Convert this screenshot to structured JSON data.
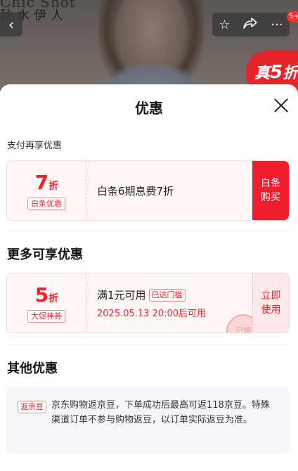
{
  "hero": {
    "brand_en": "Chic Shot",
    "brand_cn": "秋水伊人",
    "back_icon": "chevron-left-icon",
    "actions": [
      "star-icon",
      "share-icon",
      "more-icon"
    ],
    "notification_count": "5+",
    "promo_tag_prefix": "真",
    "promo_tag_num": "5",
    "promo_tag_suffix": "折"
  },
  "sheet": {
    "title": "优惠",
    "close_icon": "close-icon",
    "pay_section_label": "支付再享优惠",
    "pay_coupon": {
      "discount_num": "7",
      "discount_unit": "折",
      "tag": "白条优惠",
      "description": "白条6期息费7折",
      "action_line1": "白条",
      "action_line2": "购买"
    },
    "more_section_title": "更多可享优惠",
    "more_coupon": {
      "discount_num": "5",
      "discount_unit": "折",
      "tag": "大促神券",
      "description": "满1元可用",
      "threshold_tag": "已达门槛",
      "validity": "2025.05.13 20:00后可用",
      "action_line1": "立即",
      "action_line2": "使用",
      "stamp": "已领"
    },
    "other_section_title": "其他优惠",
    "other_item": {
      "tag": "返京豆",
      "text": "京东购物返京豆，下单成功后最高可返118京豆。特殊渠道订单不参与购物返豆，以订单实际返豆为准。"
    }
  },
  "colors": {
    "accent": "#e8242a",
    "accent_button": "#f01d2e",
    "coupon_bg": "#fff6f6",
    "other_bg": "#f5f6fa"
  }
}
